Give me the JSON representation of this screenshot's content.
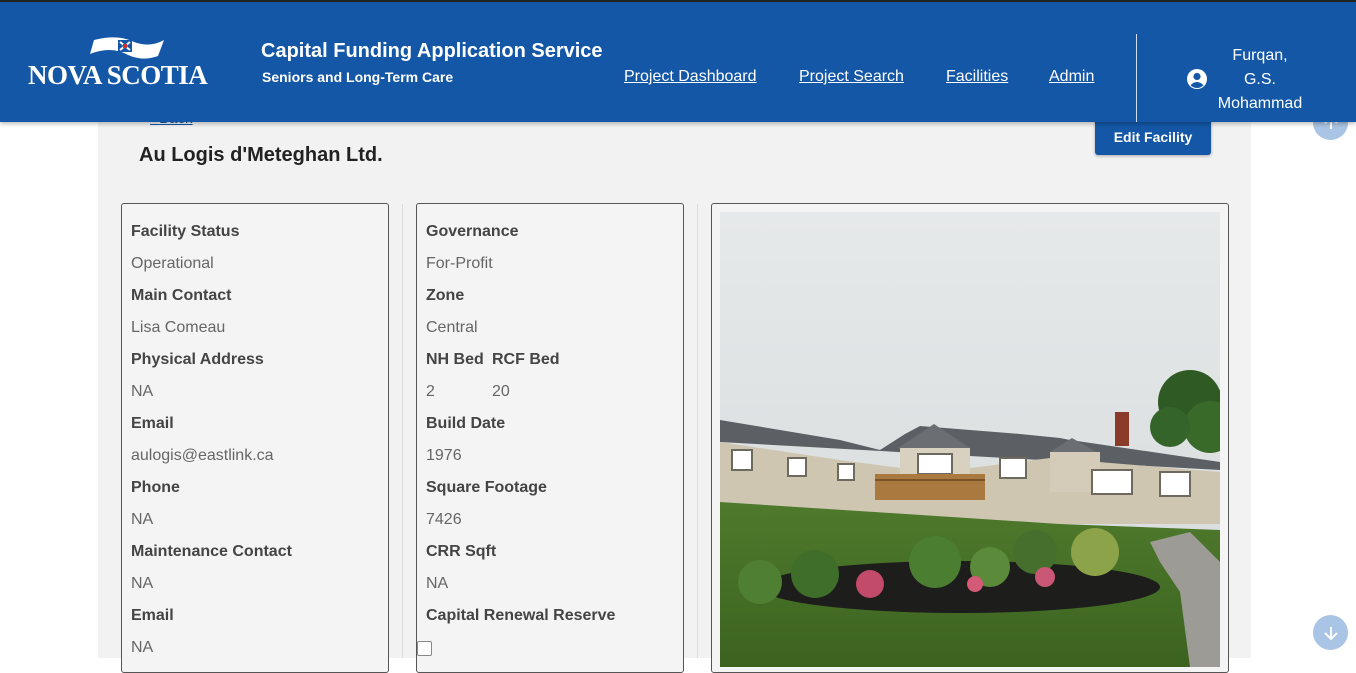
{
  "header": {
    "logo_text": "NOVA SCOTIA",
    "app_title": "Capital Funding Application Service",
    "app_subtitle": "Seniors and Long-Term Care",
    "nav": [
      "Project Dashboard",
      "Project Search",
      "Facilities",
      "Admin"
    ],
    "user": {
      "line1": "Furqan,",
      "line2": "G.S.",
      "line3": "Mohammad"
    },
    "brand_color": "#1457a6"
  },
  "page": {
    "back_label": "Back",
    "title": "Au Logis d'Meteghan Ltd.",
    "edit_button": "Edit Facility"
  },
  "details_left": {
    "facility_status_label": "Facility Status",
    "facility_status": "Operational",
    "main_contact_label": "Main Contact",
    "main_contact": "Lisa Comeau",
    "physical_address_label": "Physical Address",
    "physical_address": "NA",
    "email_label": "Email",
    "email": "aulogis@eastlink.ca",
    "phone_label": "Phone",
    "phone": "NA",
    "maintenance_contact_label": "Maintenance Contact",
    "maintenance_contact": "NA",
    "email2_label": "Email",
    "email2": "NA"
  },
  "details_mid": {
    "governance_label": "Governance",
    "governance": "For-Profit",
    "zone_label": "Zone",
    "zone": "Central",
    "nh_bed_label": "NH Bed",
    "nh_bed": "2",
    "rcf_bed_label": "RCF Bed",
    "rcf_bed": "20",
    "build_date_label": "Build Date",
    "build_date": "1976",
    "square_footage_label": "Square Footage",
    "square_footage": "7426",
    "crr_sqft_label": "CRR Sqft",
    "crr_sqft": "NA",
    "capital_renewal_label": "Capital Renewal Reserve",
    "capital_renewal_checked": false
  },
  "icons": [
    "scroll-up-icon",
    "scroll-down-icon",
    "user-icon"
  ]
}
